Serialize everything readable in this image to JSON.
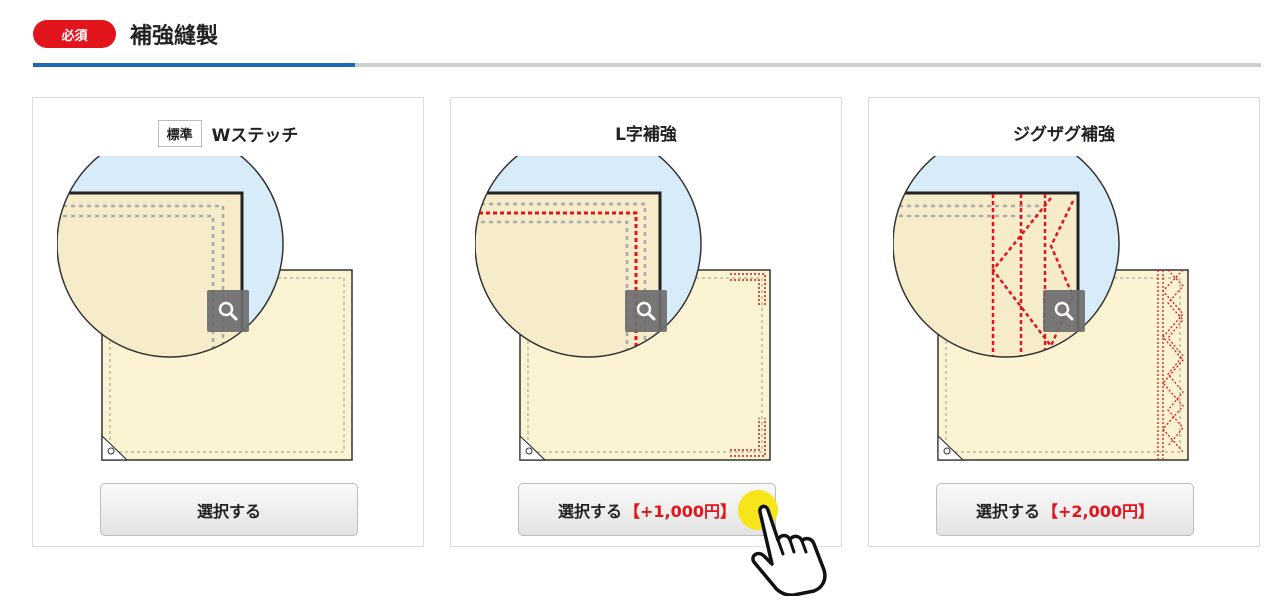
{
  "section": {
    "badge": "必須",
    "title": "補強縫製"
  },
  "colors": {
    "badge_red": "#e2141c",
    "accent_blue": "#1f67b3",
    "tarp_cream": "#fbf3d2",
    "sky_blue": "#d7ecf8",
    "stitch_red": "#e2141c",
    "cursor_yellow": "#f7e51a"
  },
  "options": [
    {
      "standard_tag": "標準",
      "title": "Wステッチ",
      "button_label": "選択する",
      "price": ""
    },
    {
      "standard_tag": "",
      "title": "L字補強",
      "button_label": "選択する",
      "price": "【+1,000円】"
    },
    {
      "standard_tag": "",
      "title": "ジグザグ補強",
      "button_label": "選択する",
      "price": "【+2,000円】"
    }
  ],
  "icons": {
    "zoom": "magnifier-icon",
    "cursor": "hand-pointer-icon"
  }
}
